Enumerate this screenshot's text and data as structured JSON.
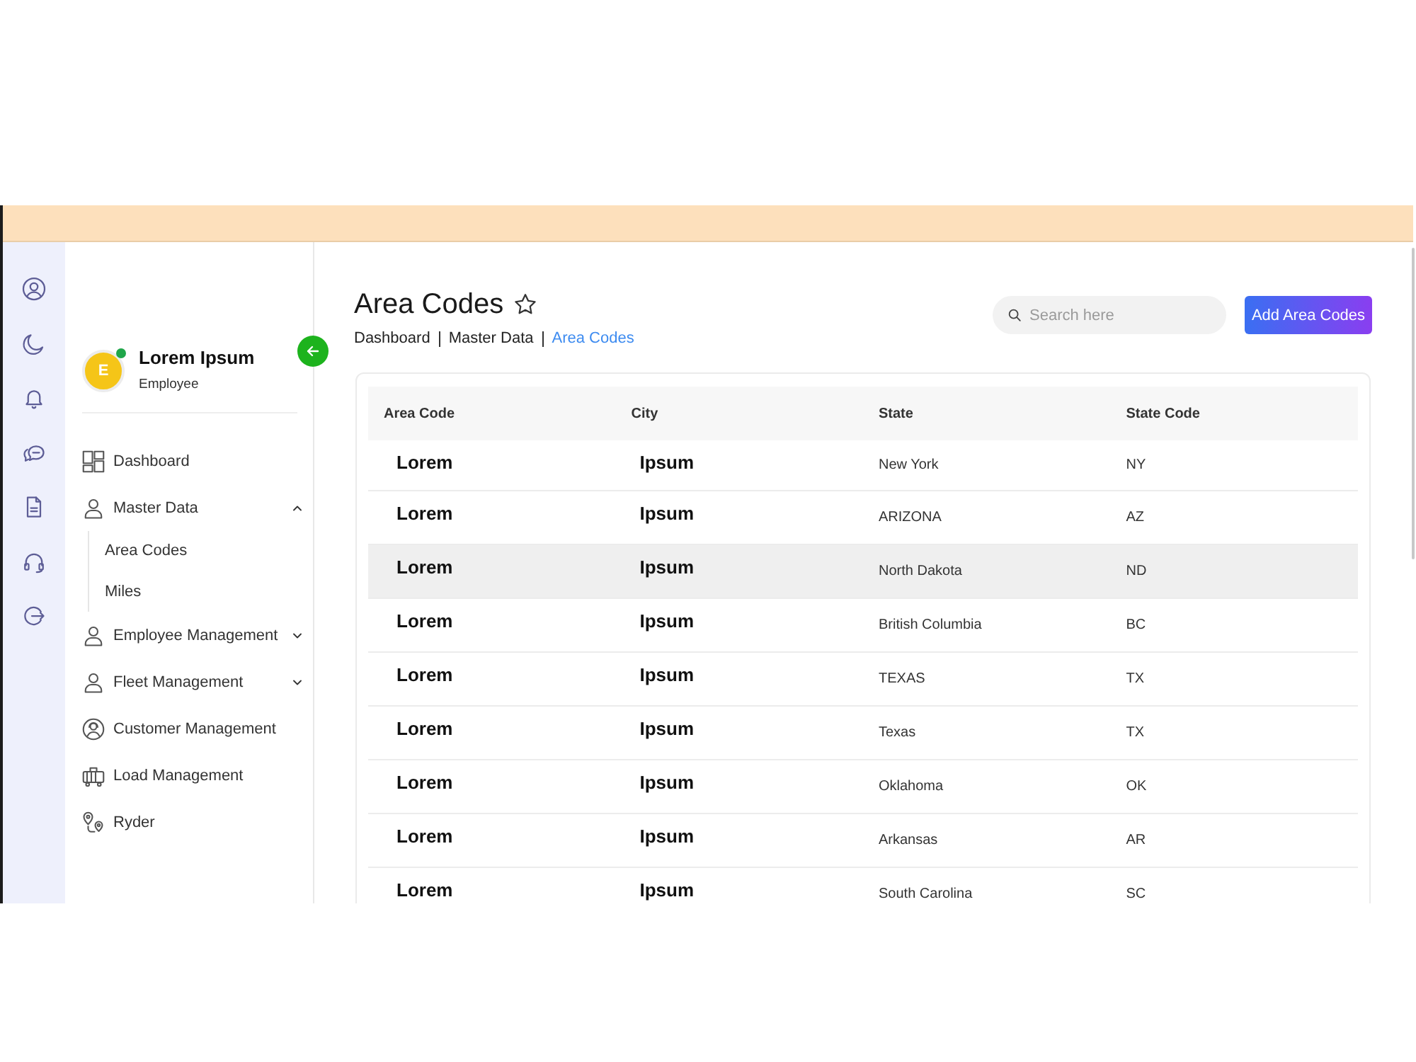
{
  "profile": {
    "initial": "E",
    "online": true,
    "name": "Lorem Ipsum",
    "role": "Employee"
  },
  "sidebar": {
    "items": [
      {
        "label": "Dashboard",
        "kind": "link"
      },
      {
        "label": "Master Data",
        "kind": "group",
        "expanded": true,
        "children": [
          {
            "label": "Area Codes"
          },
          {
            "label": "Miles"
          }
        ]
      },
      {
        "label": "Employee Management",
        "kind": "group",
        "expanded": false
      },
      {
        "label": "Fleet Management",
        "kind": "group",
        "expanded": false
      },
      {
        "label": "Customer Management",
        "kind": "link"
      },
      {
        "label": "Load Management",
        "kind": "link"
      },
      {
        "label": "Ryder",
        "kind": "link"
      }
    ]
  },
  "page": {
    "title": "Area Codes",
    "favorite": false
  },
  "breadcrumb": [
    {
      "label": "Dashboard",
      "current": false
    },
    {
      "label": "Master Data",
      "current": false
    },
    {
      "label": "Area Codes",
      "current": true
    }
  ],
  "search": {
    "placeholder": "Search here"
  },
  "add_button": {
    "label": "Add Area Codes"
  },
  "table": {
    "columns": [
      "Area Code",
      "City",
      "State",
      "State Code"
    ],
    "rows": [
      {
        "cells": [
          "Lorem",
          "Ipsum",
          "New York",
          "NY"
        ],
        "selected": false
      },
      {
        "cells": [
          "Lorem",
          "Ipsum",
          "ARIZONA",
          "AZ"
        ],
        "selected": false
      },
      {
        "cells": [
          "Lorem",
          "Ipsum",
          "North Dakota",
          "ND"
        ],
        "selected": true
      },
      {
        "cells": [
          "Lorem",
          "Ipsum",
          "British Columbia",
          "BC"
        ],
        "selected": false
      },
      {
        "cells": [
          "Lorem",
          "Ipsum",
          "TEXAS",
          "TX"
        ],
        "selected": false
      },
      {
        "cells": [
          "Lorem",
          "Ipsum",
          "Texas",
          "TX"
        ],
        "selected": false
      },
      {
        "cells": [
          "Lorem",
          "Ipsum",
          "Oklahoma",
          "OK"
        ],
        "selected": false
      },
      {
        "cells": [
          "Lorem",
          "Ipsum",
          "Arkansas",
          "AR"
        ],
        "selected": false
      },
      {
        "cells": [
          "Lorem",
          "Ipsum",
          "South Carolina",
          "SC"
        ],
        "selected": false
      }
    ]
  }
}
